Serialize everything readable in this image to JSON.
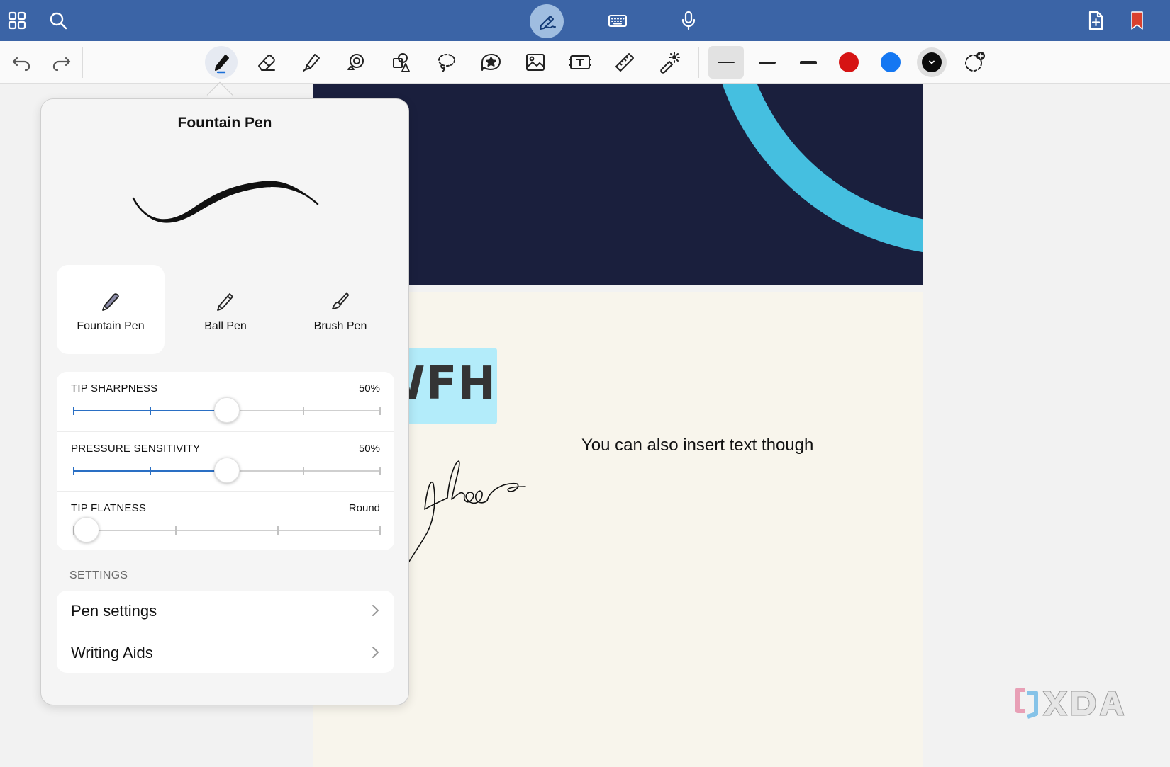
{
  "colors": {
    "topbar_bg": "#3b64a6",
    "active_tool_bg": "#9fbde0",
    "canvas_dark": "#1a1f3d",
    "canvas_arc": "#45bfe0",
    "canvas_light": "#f8f5ec",
    "highlight": "#b3ecfa",
    "slider_fill": "#2a6fc4",
    "bookmark": "#d9402e"
  },
  "topbar": {
    "icons": [
      "grid-icon",
      "search-icon",
      "pen-mode-icon",
      "keyboard-icon",
      "microphone-icon",
      "add-page-icon",
      "bookmark-icon"
    ]
  },
  "toolbar": {
    "tools": [
      "undo-icon",
      "redo-icon",
      "pen-icon",
      "eraser-icon",
      "highlighter-icon",
      "shapes-icon",
      "elements-icon",
      "lasso-icon",
      "sticker-icon",
      "image-icon",
      "text-box-icon",
      "ruler-icon",
      "laser-pointer-icon"
    ],
    "stroke_widths": [
      "thin",
      "medium",
      "thick"
    ],
    "colors": [
      "#d61414",
      "#1477f2",
      "#0b0b0b"
    ],
    "add_color_icon": "add-color-icon"
  },
  "canvas": {
    "highlighted_text": "WFH",
    "inserted_text": "You can also insert text though"
  },
  "popover": {
    "title": "Fountain Pen",
    "pen_types": [
      {
        "label": "Fountain Pen",
        "icon": "fountain-pen-icon",
        "selected": true
      },
      {
        "label": "Ball Pen",
        "icon": "ball-pen-icon",
        "selected": false
      },
      {
        "label": "Brush Pen",
        "icon": "brush-pen-icon",
        "selected": false
      }
    ],
    "sliders": [
      {
        "label": "TIP SHARPNESS",
        "value": "50%",
        "level": 0.5
      },
      {
        "label": "PRESSURE SENSITIVITY",
        "value": "50%",
        "level": 0.5
      },
      {
        "label": "TIP FLATNESS",
        "value": "Round",
        "level": 0.0
      }
    ],
    "settings_header": "SETTINGS",
    "settings_items": [
      {
        "label": "Pen settings"
      },
      {
        "label": "Writing Aids"
      }
    ]
  },
  "watermark": "XDA"
}
